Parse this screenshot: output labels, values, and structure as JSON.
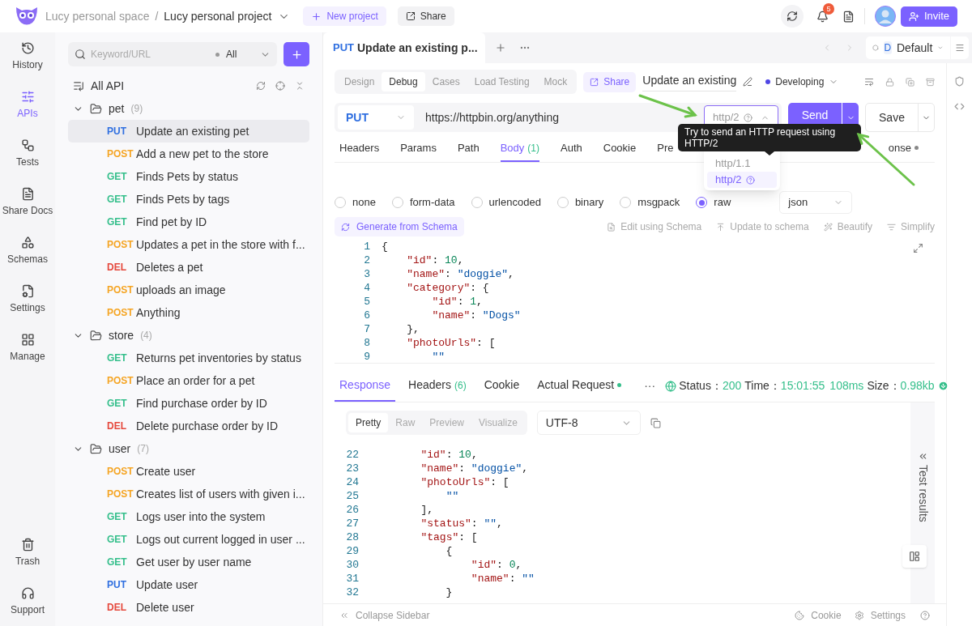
{
  "topbar": {
    "space": "Lucy personal space",
    "separator": "/",
    "project": "Lucy personal project",
    "new_project": "New project",
    "share": "Share",
    "notifications": "5",
    "invite": "Invite"
  },
  "nav": [
    {
      "label": "History",
      "selected": false
    },
    {
      "label": "APIs",
      "selected": true
    },
    {
      "label": "Tests",
      "selected": false
    },
    {
      "label": "Share Docs",
      "selected": false
    },
    {
      "label": "Schemas",
      "selected": false
    },
    {
      "label": "Settings",
      "selected": false
    },
    {
      "label": "Manage",
      "selected": false
    }
  ],
  "nav_bottom": [
    {
      "label": "Trash"
    },
    {
      "label": "Support"
    }
  ],
  "tree": {
    "search_placeholder": "Keyword/URL",
    "filter": "All",
    "root": "All API",
    "groups": [
      {
        "name": "pet",
        "count": "(9)",
        "expanded": true,
        "items": [
          {
            "method": "PUT",
            "kind": "put",
            "name": "Update an existing pet",
            "selected": true
          },
          {
            "method": "POST",
            "kind": "post",
            "name": "Add a new pet to the store",
            "selected": false
          },
          {
            "method": "GET",
            "kind": "get",
            "name": "Finds Pets by status",
            "selected": false
          },
          {
            "method": "GET",
            "kind": "get",
            "name": "Finds Pets by tags",
            "selected": false
          },
          {
            "method": "GET",
            "kind": "get",
            "name": "Find pet by ID",
            "selected": false
          },
          {
            "method": "POST",
            "kind": "post",
            "name": "Updates a pet in the store with f...",
            "selected": false
          },
          {
            "method": "DEL",
            "kind": "delete",
            "name": "Deletes a pet",
            "selected": false
          },
          {
            "method": "POST",
            "kind": "post",
            "name": "uploads an image",
            "selected": false
          },
          {
            "method": "POST",
            "kind": "post",
            "name": "Anything",
            "selected": false
          }
        ]
      },
      {
        "name": "store",
        "count": "(4)",
        "expanded": true,
        "items": [
          {
            "method": "GET",
            "kind": "get",
            "name": "Returns pet inventories by status",
            "selected": false
          },
          {
            "method": "POST",
            "kind": "post",
            "name": "Place an order for a pet",
            "selected": false
          },
          {
            "method": "GET",
            "kind": "get",
            "name": "Find purchase order by ID",
            "selected": false
          },
          {
            "method": "DEL",
            "kind": "delete",
            "name": "Delete purchase order by ID",
            "selected": false
          }
        ]
      },
      {
        "name": "user",
        "count": "(7)",
        "expanded": true,
        "items": [
          {
            "method": "POST",
            "kind": "post",
            "name": "Create user",
            "selected": false
          },
          {
            "method": "POST",
            "kind": "post",
            "name": "Creates list of users with given i...",
            "selected": false
          },
          {
            "method": "GET",
            "kind": "get",
            "name": "Logs user into the system",
            "selected": false
          },
          {
            "method": "GET",
            "kind": "get",
            "name": "Logs out current logged in user ...",
            "selected": false
          },
          {
            "method": "GET",
            "kind": "get",
            "name": "Get user by user name",
            "selected": false
          },
          {
            "method": "PUT",
            "kind": "put",
            "name": "Update user",
            "selected": false
          },
          {
            "method": "DEL",
            "kind": "delete",
            "name": "Delete user",
            "selected": false
          }
        ]
      }
    ]
  },
  "tab": {
    "method": "PUT",
    "title": "Update an existing p..."
  },
  "environment": {
    "badge": "D",
    "name": "Default"
  },
  "modes": [
    {
      "label": "Design",
      "selected": false
    },
    {
      "label": "Debug",
      "selected": true
    },
    {
      "label": "Cases",
      "selected": false
    },
    {
      "label": "Load Testing",
      "selected": false
    },
    {
      "label": "Mock",
      "selected": false
    }
  ],
  "share_button": "Share",
  "api_name": "Update an existing",
  "api_status": "Developing",
  "request": {
    "method": "PUT",
    "url": "https://httpbin.org/anything",
    "protocol": "http/2",
    "send": "Send",
    "save": "Save"
  },
  "request_tabs": [
    {
      "label": "Headers",
      "selected": false,
      "dot": false
    },
    {
      "label": "Params",
      "selected": false,
      "dot": false
    },
    {
      "label": "Path",
      "selected": false,
      "dot": false
    },
    {
      "label": "Body",
      "count": "(1)",
      "selected": true,
      "dot": false
    },
    {
      "label": "Auth",
      "selected": false,
      "dot": false
    },
    {
      "label": "Cookie",
      "selected": false,
      "dot": false
    },
    {
      "label": "Pre",
      "selected": false,
      "dot": false
    },
    {
      "label": "onse",
      "selected": false,
      "dot": true
    }
  ],
  "tooltip": "Try to send an HTTP request using HTTP/2",
  "protocol_menu": [
    {
      "label": "http/1.1",
      "selected": false
    },
    {
      "label": "http/2",
      "selected": true
    }
  ],
  "body_types": [
    {
      "label": "none",
      "selected": false
    },
    {
      "label": "form-data",
      "selected": false
    },
    {
      "label": "urlencoded",
      "selected": false
    },
    {
      "label": "binary",
      "selected": false
    },
    {
      "label": "msgpack",
      "selected": false
    },
    {
      "label": "raw",
      "selected": true
    }
  ],
  "body_format": "json",
  "body_tools": {
    "generate": "Generate from Schema",
    "actions": [
      "Edit using Schema",
      "Update to schema",
      "Beautify",
      "Simplify"
    ]
  },
  "request_body": {
    "lines": [
      {
        "number": "1",
        "code": "{"
      },
      {
        "number": "2",
        "code": "    \"id\": 10,"
      },
      {
        "number": "3",
        "code": "    \"name\": \"doggie\","
      },
      {
        "number": "4",
        "code": "    \"category\": {"
      },
      {
        "number": "5",
        "code": "        \"id\": 1,"
      },
      {
        "number": "6",
        "code": "        \"name\": \"Dogs\""
      },
      {
        "number": "7",
        "code": "    },"
      },
      {
        "number": "8",
        "code": "    \"photoUrls\": ["
      },
      {
        "number": "9",
        "code": "        \"\""
      }
    ]
  },
  "response_tabs": [
    {
      "label": "Response",
      "selected": true,
      "dot": false
    },
    {
      "label": "Headers",
      "count": "(6)",
      "selected": false,
      "dot": false
    },
    {
      "label": "Cookie",
      "selected": false,
      "dot": false
    },
    {
      "label": "Actual Request",
      "selected": false,
      "dot": true
    }
  ],
  "response_status": {
    "more": "···",
    "status_label": "Status：",
    "status": "200",
    "time_label": "Time：",
    "time": "15:01:55",
    "duration": "108ms",
    "size_label": "Size：",
    "size": "0.98kb"
  },
  "view_modes": [
    {
      "label": "Pretty",
      "selected": true
    },
    {
      "label": "Raw",
      "selected": false
    },
    {
      "label": "Preview",
      "selected": false
    },
    {
      "label": "Visualize",
      "selected": false
    }
  ],
  "encoding": "UTF-8",
  "response_body": {
    "lines": [
      {
        "number": "22",
        "code": "        \"id\": 10,"
      },
      {
        "number": "23",
        "code": "        \"name\": \"doggie\","
      },
      {
        "number": "24",
        "code": "        \"photoUrls\": ["
      },
      {
        "number": "25",
        "code": "            \"\""
      },
      {
        "number": "26",
        "code": "        ],"
      },
      {
        "number": "27",
        "code": "        \"status\": \"\","
      },
      {
        "number": "28",
        "code": "        \"tags\": ["
      },
      {
        "number": "29",
        "code": "            {"
      },
      {
        "number": "30",
        "code": "                \"id\": 0,"
      },
      {
        "number": "31",
        "code": "                \"name\": \"\""
      },
      {
        "number": "32",
        "code": "            }"
      }
    ]
  },
  "test_results": "Test results",
  "footer": {
    "collapse": "Collapse Sidebar",
    "cookie": "Cookie",
    "settings": "Settings"
  }
}
